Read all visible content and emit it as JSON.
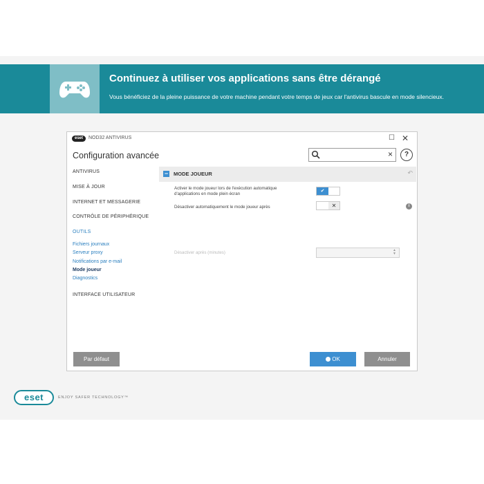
{
  "banner": {
    "title": "Continuez à utiliser vos applications sans être dérangé",
    "subtitle": "Vous bénéficiez de la pleine puissance de votre machine pendant votre temps de jeux car l'antivirus bascule en mode silencieux.",
    "icon": "gamepad-icon",
    "color": "#1a8a99"
  },
  "window": {
    "brand": "eset",
    "app_name": "NOD32 ANTIVIRUS",
    "title": "Configuration avancée",
    "search": {
      "value": "",
      "placeholder": ""
    },
    "help_label": "?"
  },
  "sidebar": {
    "items": [
      {
        "label": "ANTIVIRUS"
      },
      {
        "label": "MISE À JOUR"
      },
      {
        "label": "INTERNET ET MESSAGERIE"
      },
      {
        "label": "CONTRÔLE DE PÉRIPHÉRIQUE"
      },
      {
        "label": "OUTILS"
      },
      {
        "label": "INTERFACE UTILISATEUR"
      }
    ],
    "subitems": [
      {
        "label": "Fichiers journaux"
      },
      {
        "label": "Serveur proxy"
      },
      {
        "label": "Notifications par e-mail"
      },
      {
        "label": "Mode joueur",
        "active": true
      },
      {
        "label": "Diagnostics"
      }
    ]
  },
  "section": {
    "title": "MODE JOUEUR",
    "options": [
      {
        "label_line1": "Activer le mode joueur lors de l'exécution automatique",
        "label_line2": "d'applications en mode plein écran",
        "enabled": true
      },
      {
        "label": "Désactiver automatiquement le mode joueur après",
        "enabled": false
      },
      {
        "label": "Désactiver après (minutes)",
        "disabled": true
      }
    ]
  },
  "buttons": {
    "default": "Par défaut",
    "ok": "OK",
    "cancel": "Annuler"
  },
  "footer": {
    "logo": "eset",
    "tagline": "ENJOY SAFER TECHNOLOGY™"
  },
  "colors": {
    "accent": "#3d8fd1",
    "teal": "#1a8a99"
  }
}
